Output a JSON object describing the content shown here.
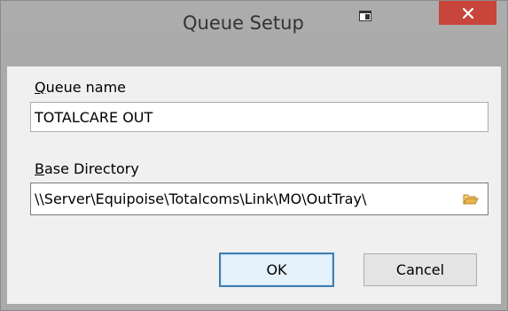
{
  "window": {
    "title": "Queue Setup",
    "close_glyph": "✕",
    "restore_icon": "window-restore-icon"
  },
  "form": {
    "queue_name": {
      "label_accel": "Q",
      "label_rest": "ueue name",
      "value": "TOTALCARE OUT"
    },
    "base_directory": {
      "label_accel": "B",
      "label_rest": "ase Directory",
      "value": "\\\\Server\\Equipoise\\Totalcoms\\Link\\MO\\OutTray\\",
      "browse_icon": "folder-open-icon"
    }
  },
  "buttons": {
    "ok_label": "OK",
    "cancel_label": "Cancel"
  },
  "colors": {
    "titlebar": "#acacac",
    "close_button": "#c7453a",
    "client_area": "#f0f0f0",
    "default_button_border": "#3c7fb1",
    "folder_icon": "#e8b64a"
  }
}
